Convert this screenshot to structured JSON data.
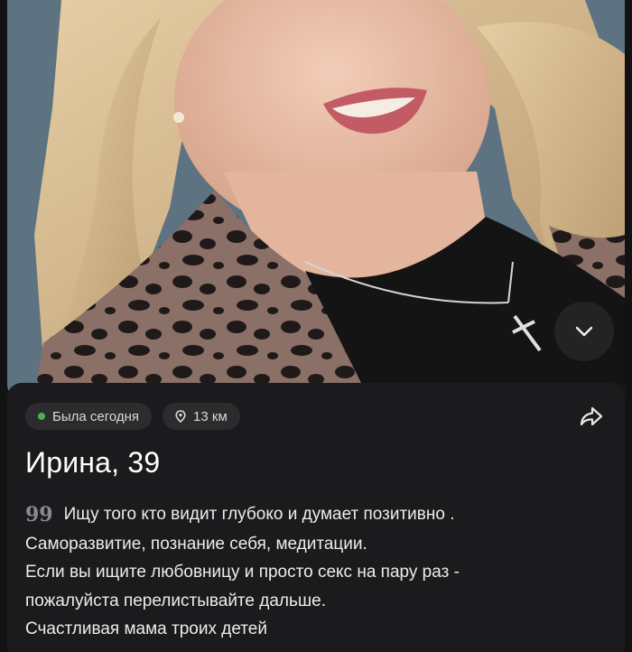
{
  "profile": {
    "status": "Была сегодня",
    "distance": "13 км",
    "name_age": "Ирина, 39",
    "bio_lines": [
      "Ищу того кто видит глубоко и думает позитивно .",
      "Саморазвитие, познание себя, медитации.",
      "Если вы ищите любовницу и просто секс на пару раз -",
      "пожалуйста перелистывайте дальше.",
      "Счастливая мама троих детей"
    ]
  },
  "icons": {
    "status": "online-dot-icon",
    "distance": "location-pin-icon",
    "share": "share-arrow-icon",
    "collapse": "chevron-down-icon",
    "quote": "quote-icon"
  },
  "colors": {
    "background": "#121212",
    "card": "#1b1b1d",
    "chip": "#2c2c2f",
    "online": "#4bb34b",
    "text": "#ffffff"
  }
}
